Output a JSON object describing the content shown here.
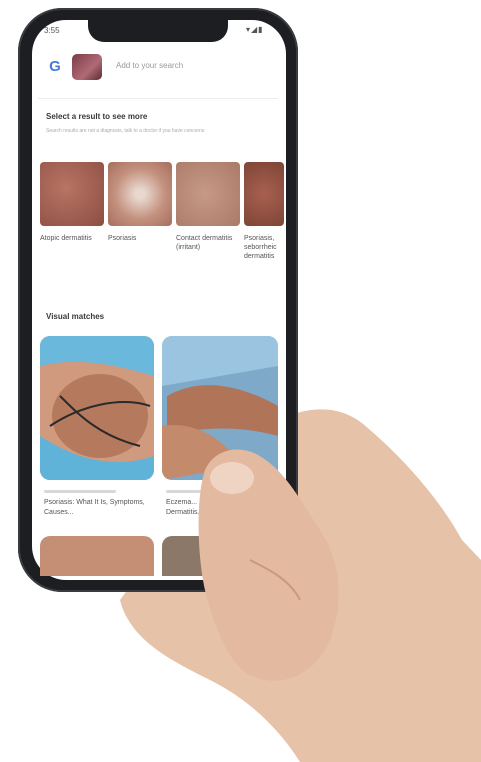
{
  "status": {
    "time": "3:55",
    "icons": "▾◢▮"
  },
  "search": {
    "logo": "G",
    "placeholder": "Add to your search"
  },
  "refine": {
    "title": "Select a result to see more",
    "helper": "Search results are not a diagnosis, talk to a doctor if you have concerns",
    "results": [
      {
        "label": "Atopic dermatitis",
        "color": "#a26656"
      },
      {
        "label": "Psoriasis",
        "color": "#c4917e"
      },
      {
        "label": "Contact dermatitis (irritant)",
        "color": "#b88a76"
      },
      {
        "label": "Psoriasis, seborrheic dermatitis",
        "color": "#9c5a4c"
      }
    ]
  },
  "visual_matches": {
    "title": "Visual matches",
    "cards": [
      {
        "caption": "Psoriasis: What It Is, Symptoms, Causes..."
      },
      {
        "caption": "Eczema... Dermatitis..."
      }
    ]
  },
  "colors": {
    "phone_frame": "#1d1e22",
    "google_blue": "#4a78d8",
    "skin_tone": "#e3b9a0",
    "fabric_blue": "#5fb3d9"
  }
}
